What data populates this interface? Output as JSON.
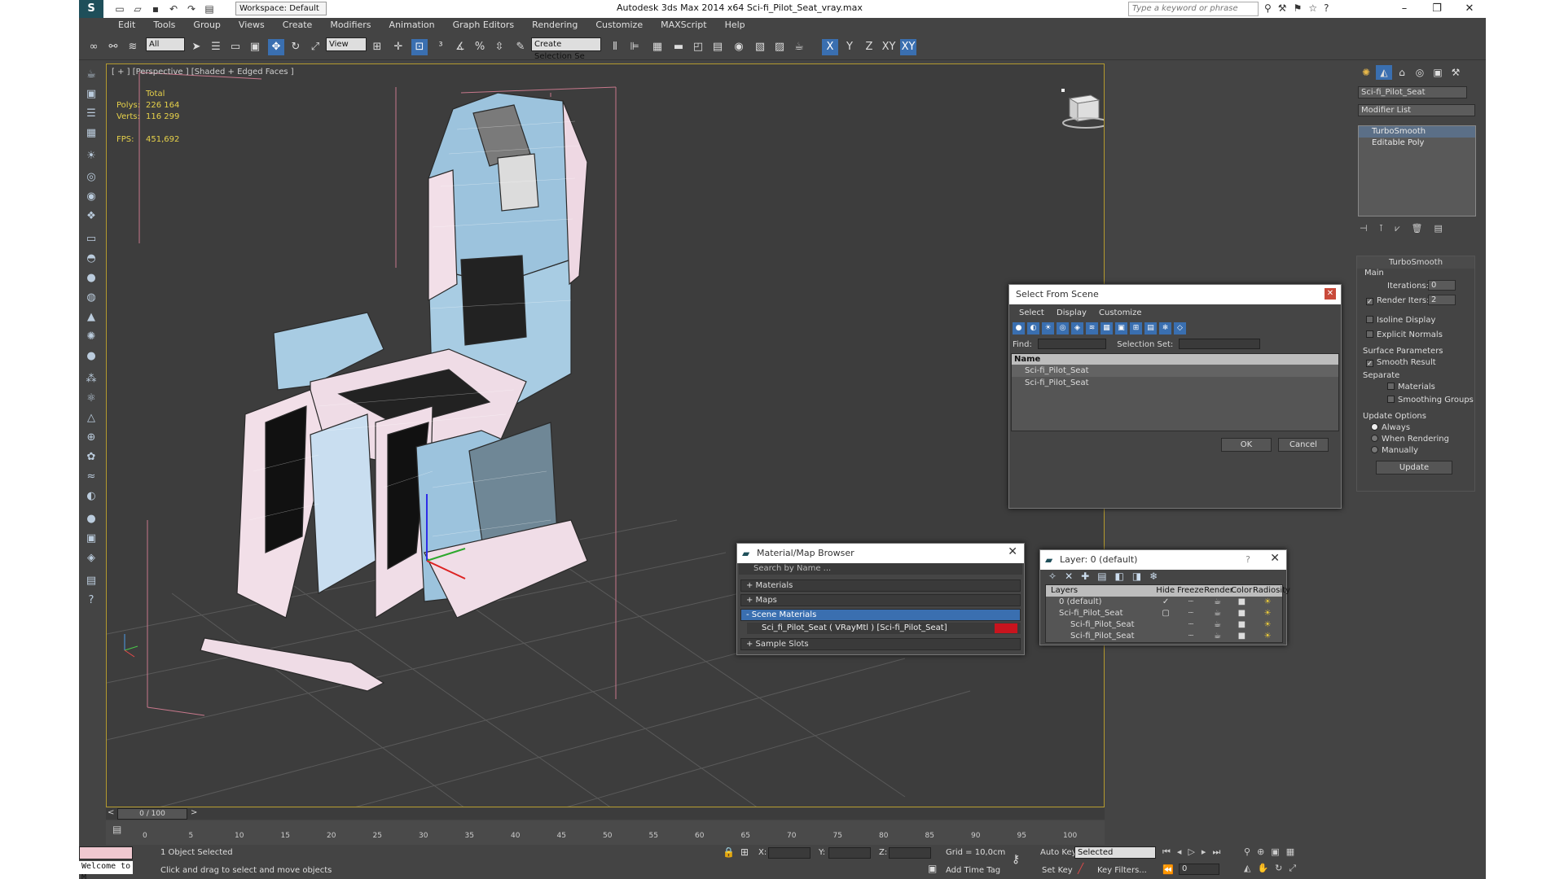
{
  "titlebar": {
    "workspace": "Workspace: Default",
    "title": "Autodesk 3ds Max  2014 x64      Sci-fi_Pilot_Seat_vray.max",
    "search_placeholder": "Type a keyword or phrase"
  },
  "menubar": [
    "Edit",
    "Tools",
    "Group",
    "Views",
    "Create",
    "Modifiers",
    "Animation",
    "Graph Editors",
    "Rendering",
    "Customize",
    "MAXScript",
    "Help"
  ],
  "toolbar": {
    "selection_filter": "All",
    "ref_coord": "View",
    "named_selection": "Create Selection Se",
    "axis_x": "X",
    "axis_y": "Y",
    "axis_z": "Z",
    "axis_xy": "XY",
    "axis_xy2": "XY"
  },
  "viewport": {
    "label": "[ + ] [Perspective ] [Shaded + Edged Faces ]",
    "stats": {
      "total_label": "Total",
      "polys_label": "Polys:",
      "polys": "226 164",
      "verts_label": "Verts:",
      "verts": "116 299",
      "fps_label": "FPS:",
      "fps": "451,692"
    }
  },
  "cmdpanel": {
    "object_name": "Sci-fi_Pilot_Seat",
    "modifier_list": "Modifier List",
    "stack": [
      "TurboSmooth",
      "Editable Poly"
    ],
    "rollout_title": "TurboSmooth",
    "main_label": "Main",
    "iterations_label": "Iterations:",
    "iterations": "0",
    "render_iters_label": "Render Iters:",
    "render_iters": "2",
    "isoline": "Isoline Display",
    "explicit": "Explicit Normals",
    "surface_params": "Surface Parameters",
    "smooth_result": "Smooth Result",
    "separate": "Separate",
    "materials": "Materials",
    "smoothing_groups": "Smoothing Groups",
    "update_options": "Update Options",
    "always": "Always",
    "when_rendering": "When Rendering",
    "manually": "Manually",
    "update": "Update"
  },
  "select_from_scene": {
    "title": "Select From Scene",
    "menu": [
      "Select",
      "Display",
      "Customize"
    ],
    "find_label": "Find:",
    "selection_set_label": "Selection Set:",
    "column": "Name",
    "rows": [
      "Sci-fi_Pilot_Seat",
      "Sci-fi_Pilot_Seat"
    ],
    "ok": "OK",
    "cancel": "Cancel"
  },
  "material_browser": {
    "title": "Material/Map Browser",
    "search": "Search by Name ...",
    "groups": [
      "+ Materials",
      "+ Maps",
      "- Scene Materials",
      "+ Sample Slots"
    ],
    "scene_material": "Sci_fi_Pilot_Seat  ( VRayMtl ) [Sci-fi_Pilot_Seat]"
  },
  "layers": {
    "title": "Layer: 0 (default)",
    "help": "?",
    "columns": [
      "Layers",
      "Hide",
      "Freeze",
      "Render",
      "Color",
      "Radiosity"
    ],
    "rows": [
      "0 (default)",
      "Sci-fi_Pilot_Seat",
      "Sci-fi_Pilot_Seat",
      "Sci-fi_Pilot_Seat"
    ]
  },
  "timeline": {
    "frame": "0 / 100",
    "ticks": [
      "0",
      "5",
      "10",
      "15",
      "20",
      "25",
      "30",
      "35",
      "40",
      "45",
      "50",
      "55",
      "60",
      "65",
      "70",
      "75",
      "80",
      "85",
      "90",
      "95",
      "100"
    ]
  },
  "statusbar": {
    "maxscript": "Welcome to M",
    "selected": "1 Object Selected",
    "prompt": "Click and drag to select and move objects",
    "x_label": "X:",
    "y_label": "Y:",
    "z_label": "Z:",
    "grid": "Grid = 10,0cm",
    "add_time_tag": "Add Time Tag",
    "auto_key": "Auto Key",
    "set_key": "Set Key",
    "key_mode": "Selected",
    "key_filters": "Key Filters...",
    "frame_field": "0"
  },
  "colors": {
    "accent": "#3a6fb0",
    "viewport_border": "#b49a2e",
    "stats": "#e6d14a",
    "material_swatch": "#c8141e"
  }
}
